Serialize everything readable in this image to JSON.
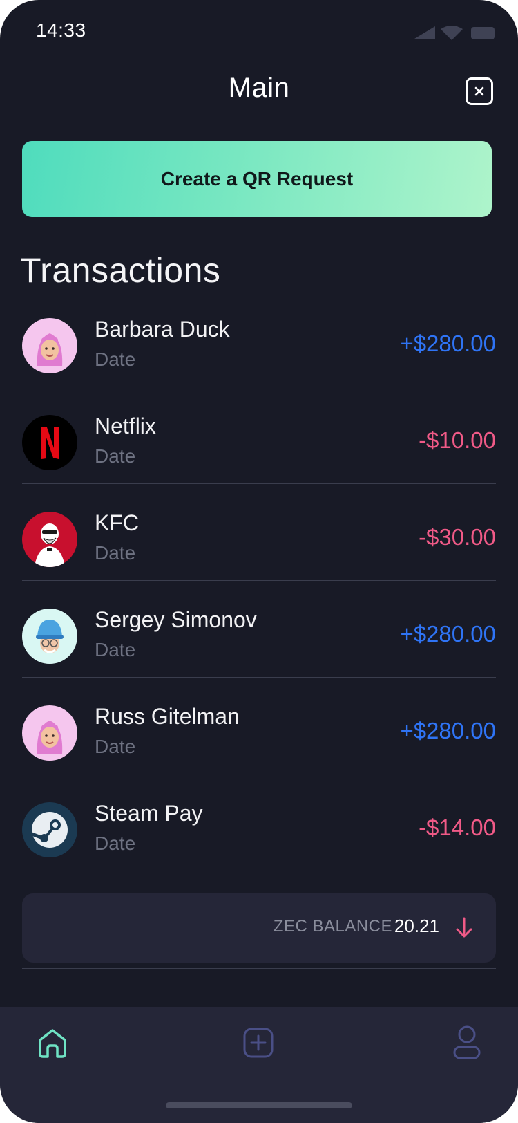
{
  "status_bar": {
    "time": "14:33"
  },
  "header": {
    "title": "Main"
  },
  "qr_request": {
    "label": "Create a QR Request"
  },
  "transactions": {
    "title": "Transactions",
    "items": [
      {
        "name": "Barbara Duck",
        "date": "Date",
        "amount": "+$280.00",
        "icon": "memoji-avatar-icon"
      },
      {
        "name": "Netflix",
        "date": "Date",
        "amount": "-$10.00",
        "icon": "netflix-logo-icon"
      },
      {
        "name": "KFC",
        "date": "Date",
        "amount": "-$30.00",
        "icon": "kfc-logo-icon"
      },
      {
        "name": "Sergey Simonov",
        "date": "Date",
        "amount": "+$280.00",
        "icon": "memoji-avatar-icon"
      },
      {
        "name": "Russ Gitelman",
        "date": "Date",
        "amount": "+$280.00",
        "icon": "memoji-avatar-icon"
      },
      {
        "name": "Steam Pay",
        "date": "Date",
        "amount": "-$14.00",
        "icon": "steam-logo-icon"
      }
    ]
  },
  "balance": {
    "label": "ZEC BALANCE",
    "value": "20.21"
  },
  "tab_bar": {
    "tabs": [
      "home-icon",
      "add-square-icon",
      "profile-icon"
    ]
  },
  "colors": {
    "background": "#181a26",
    "positive": "#2f74f5",
    "negative": "#f05a87",
    "accent": "#4fdcbd"
  }
}
